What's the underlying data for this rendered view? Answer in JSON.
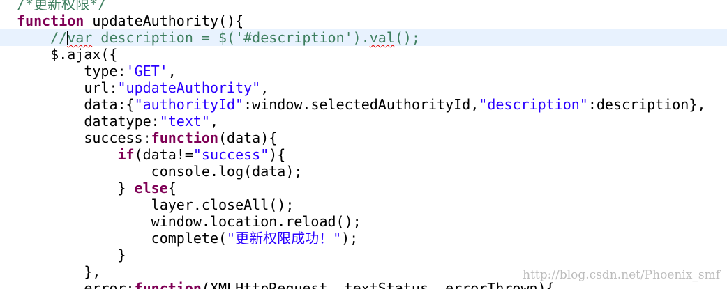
{
  "editor": {
    "lines": [
      {
        "tokens": [
          {
            "t": "cmt",
            "v": "/*更新权限*/"
          }
        ]
      },
      {
        "tokens": [
          {
            "t": "kw",
            "v": "function"
          },
          {
            "t": "plain",
            "v": " updateAuthority(){"
          }
        ]
      },
      {
        "tokens": [
          {
            "t": "cmt",
            "v": "    //"
          },
          {
            "t": "caret",
            "v": ""
          },
          {
            "t": "cmt-squiggle",
            "v": "var"
          },
          {
            "t": "cmt",
            "v": " description = $('#description')."
          },
          {
            "t": "cmt-squiggle",
            "v": "val"
          },
          {
            "t": "cmt",
            "v": "();"
          }
        ],
        "current": true
      },
      {
        "tokens": [
          {
            "t": "plain",
            "v": "    $.ajax({"
          }
        ]
      },
      {
        "tokens": [
          {
            "t": "plain",
            "v": "        type:"
          },
          {
            "t": "str",
            "v": "'GET'"
          },
          {
            "t": "plain",
            "v": ","
          }
        ]
      },
      {
        "tokens": [
          {
            "t": "plain",
            "v": "        url:"
          },
          {
            "t": "str",
            "v": "\"updateAuthority\""
          },
          {
            "t": "plain",
            "v": ","
          }
        ]
      },
      {
        "tokens": [
          {
            "t": "plain",
            "v": "        data:{"
          },
          {
            "t": "str",
            "v": "\"authorityId\""
          },
          {
            "t": "plain",
            "v": ":window.selectedAuthorityId,"
          },
          {
            "t": "str",
            "v": "\"description\""
          },
          {
            "t": "plain",
            "v": ":description},"
          }
        ]
      },
      {
        "tokens": [
          {
            "t": "plain",
            "v": "        datatype:"
          },
          {
            "t": "str",
            "v": "\"text\""
          },
          {
            "t": "plain",
            "v": ","
          }
        ]
      },
      {
        "tokens": [
          {
            "t": "plain",
            "v": "        success:"
          },
          {
            "t": "kw",
            "v": "function"
          },
          {
            "t": "plain",
            "v": "(data){"
          }
        ]
      },
      {
        "tokens": [
          {
            "t": "plain",
            "v": "            "
          },
          {
            "t": "kw",
            "v": "if"
          },
          {
            "t": "plain",
            "v": "(data!="
          },
          {
            "t": "str",
            "v": "\"success\""
          },
          {
            "t": "plain",
            "v": "){"
          }
        ]
      },
      {
        "tokens": [
          {
            "t": "plain",
            "v": "                console.log(data);"
          }
        ]
      },
      {
        "tokens": [
          {
            "t": "plain",
            "v": "            } "
          },
          {
            "t": "kw",
            "v": "else"
          },
          {
            "t": "plain",
            "v": "{"
          }
        ]
      },
      {
        "tokens": [
          {
            "t": "plain",
            "v": "                layer.closeAll();"
          }
        ]
      },
      {
        "tokens": [
          {
            "t": "plain",
            "v": "                window.location.reload();"
          }
        ]
      },
      {
        "tokens": [
          {
            "t": "plain",
            "v": "                complete("
          },
          {
            "t": "str",
            "v": "\"更新权限成功！\""
          },
          {
            "t": "plain",
            "v": ");"
          }
        ]
      },
      {
        "tokens": [
          {
            "t": "plain",
            "v": "            }"
          }
        ]
      },
      {
        "tokens": [
          {
            "t": "plain",
            "v": "        },"
          }
        ]
      },
      {
        "tokens": [
          {
            "t": "plain",
            "v": "        error:"
          },
          {
            "t": "kw",
            "v": "function"
          },
          {
            "t": "plain",
            "v": "(XMLHttpRequest, textStatus, errorThrown){"
          }
        ]
      }
    ]
  },
  "watermark": {
    "text": "http://blog.csdn.net/Phoenix_smf"
  },
  "colors": {
    "keyword": "#7f0055",
    "string": "#2a00ff",
    "comment": "#3f7f5f",
    "current_line": "#e8f2fe",
    "squiggle": "#e00000"
  }
}
